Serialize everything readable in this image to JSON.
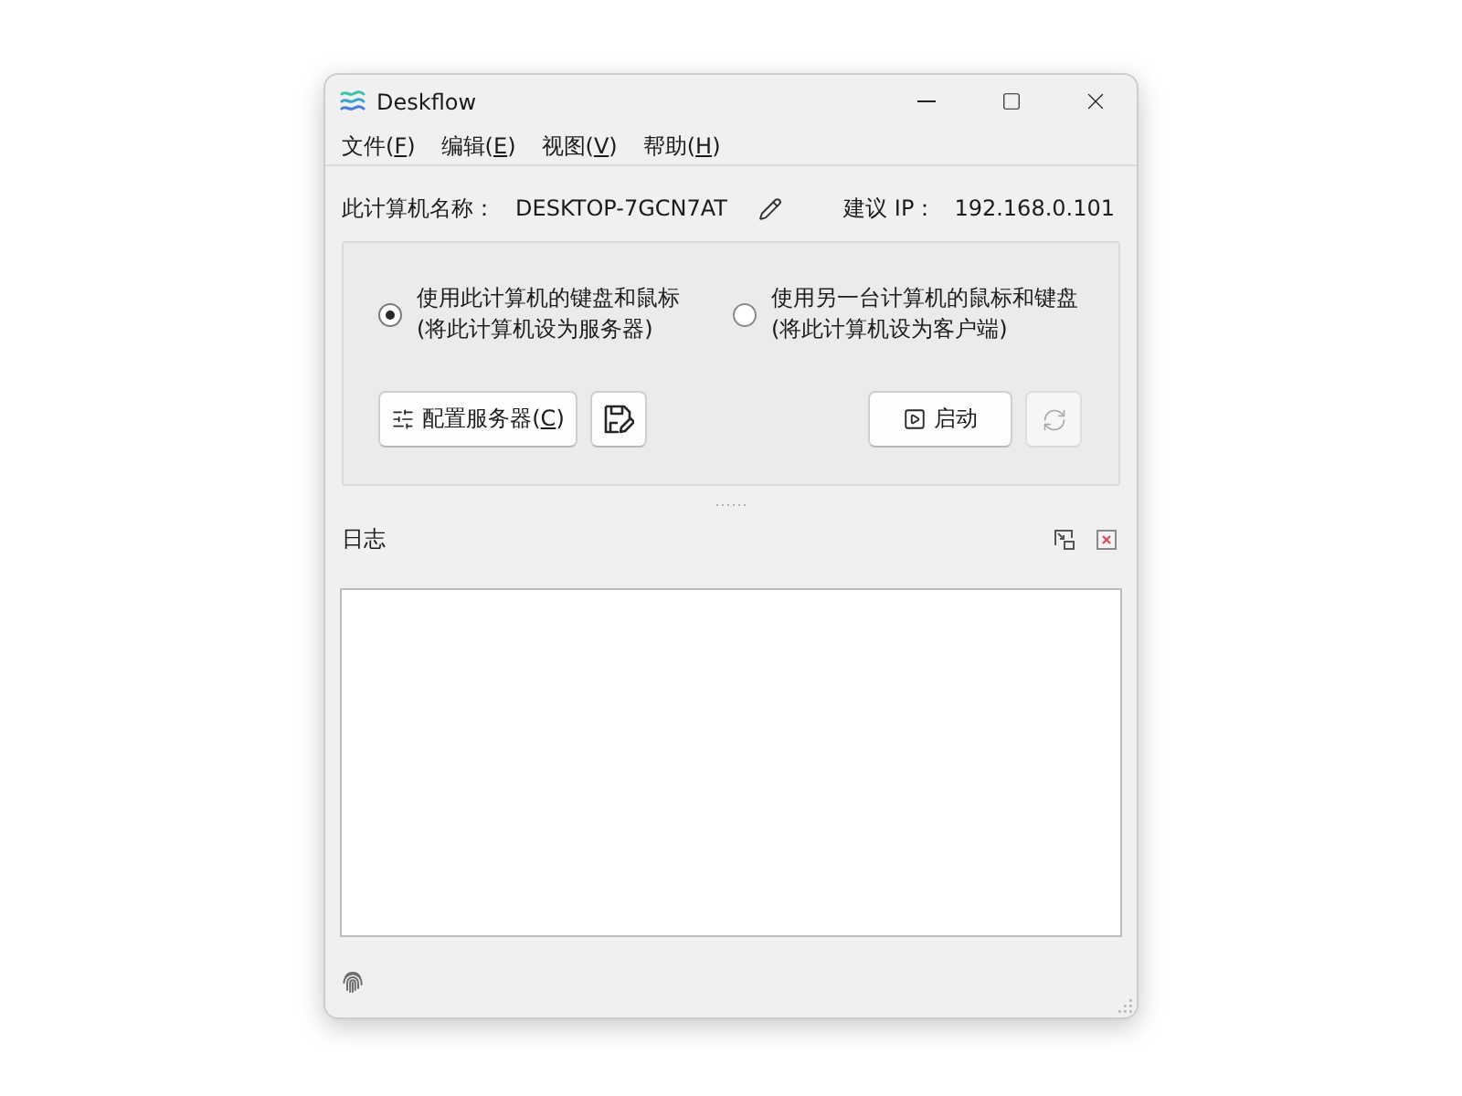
{
  "window": {
    "title": "Deskflow"
  },
  "menu": [
    {
      "before": "文件(",
      "key": "F",
      "after": ")"
    },
    {
      "before": "编辑(",
      "key": "E",
      "after": ")"
    },
    {
      "before": "视图(",
      "key": "V",
      "after": ")"
    },
    {
      "before": "帮助(",
      "key": "H",
      "after": ")"
    }
  ],
  "computer": {
    "name_label": "此计算机名称：",
    "name": "DESKTOP-7GCN7AT",
    "ip_label": "建议 IP：",
    "ip": "192.168.0.101"
  },
  "modes": [
    {
      "label": "使用此计算机的键盘和鼠标",
      "hint": "(将此计算机设为服务器)",
      "selected": true
    },
    {
      "label": "使用另一台计算机的鼠标和键盘",
      "hint": "(将此计算机设为客户端)",
      "selected": false
    }
  ],
  "actions": {
    "left": [
      {
        "kind": "configure",
        "before": "配置服务器(",
        "key": "C",
        "after": ")",
        "disabled": false
      },
      {
        "kind": "save",
        "disabled": false
      }
    ],
    "right": [
      {
        "kind": "start",
        "label": "启动",
        "disabled": false
      },
      {
        "kind": "restart",
        "disabled": true
      }
    ]
  },
  "log": {
    "title": "日志"
  }
}
